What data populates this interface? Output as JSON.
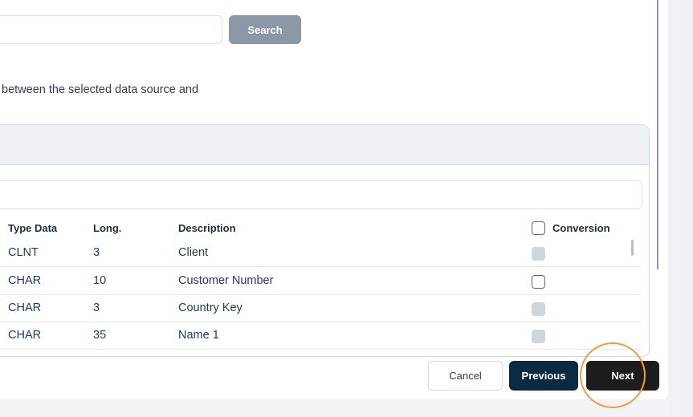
{
  "search": {
    "value": "",
    "placeholder": "",
    "button_label": "Search"
  },
  "description": "between the selected data source and",
  "table": {
    "columns": {
      "type_data": "Type Data",
      "long": "Long.",
      "description": "Description",
      "conversion": "Conversion"
    },
    "rows": [
      {
        "type": "CLNT",
        "long": "3",
        "description": "Client",
        "conversion_state": "disabled"
      },
      {
        "type": "CHAR",
        "long": "10",
        "description": "Customer Number",
        "conversion_state": "unchecked"
      },
      {
        "type": "CHAR",
        "long": "3",
        "description": "Country Key",
        "conversion_state": "disabled"
      },
      {
        "type": "CHAR",
        "long": "35",
        "description": "Name 1",
        "conversion_state": "disabled"
      }
    ]
  },
  "footer": {
    "cancel_label": "Cancel",
    "previous_label": "Previous",
    "next_label": "Next"
  },
  "colors": {
    "highlight_ring": "#f39a3d",
    "previous_button": "#0b2a42",
    "next_button": "#1d1d1d",
    "search_button": "#8c98a5"
  }
}
